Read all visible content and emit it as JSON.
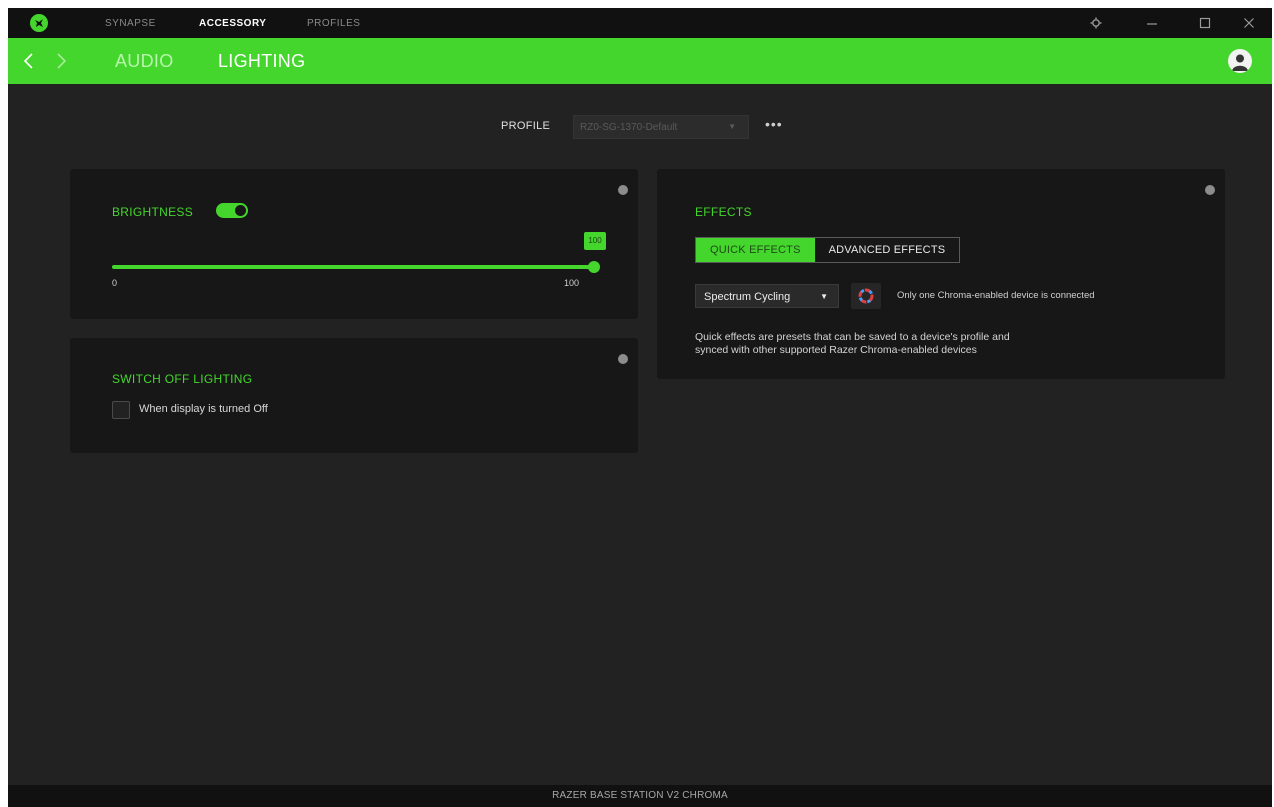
{
  "nav": {
    "tabs": [
      {
        "label": "SYNAPSE"
      },
      {
        "label": "ACCESSORY"
      },
      {
        "label": "PROFILES"
      }
    ]
  },
  "subnav": {
    "tabs": [
      {
        "label": "AUDIO"
      },
      {
        "label": "LIGHTING"
      }
    ]
  },
  "profile": {
    "label": "PROFILE",
    "selected": "RZ0-SG-1370-Default",
    "more": "•••"
  },
  "brightness": {
    "title": "BRIGHTNESS",
    "enabled": true,
    "value": 100,
    "value_label": "100",
    "min_label": "0",
    "max_label": "100"
  },
  "switch_off": {
    "title": "SWITCH OFF LIGHTING",
    "option_label": "When display is turned Off",
    "checked": false
  },
  "effects": {
    "title": "EFFECTS",
    "tabs": [
      {
        "label": "QUICK EFFECTS"
      },
      {
        "label": "ADVANCED EFFECTS"
      }
    ],
    "selected_effect": "Spectrum Cycling",
    "chroma_note": "Only one Chroma-enabled device is connected",
    "description_line1": "Quick effects are presets that can be saved to a device's profile and",
    "description_line2": "synced with other supported Razer Chroma-enabled devices"
  },
  "footer": {
    "device": "RAZER BASE STATION V2 CHROMA"
  },
  "colors": {
    "accent": "#44d62c",
    "background": "#222222",
    "card": "#171717",
    "titlebar": "#111111"
  },
  "icons": [
    "razer-logo-icon",
    "gear-icon",
    "minimize-icon",
    "maximize-icon",
    "close-icon",
    "back-arrow-icon",
    "forward-arrow-icon",
    "user-avatar-icon",
    "help-icon",
    "chroma-icon",
    "caret-down-icon"
  ]
}
